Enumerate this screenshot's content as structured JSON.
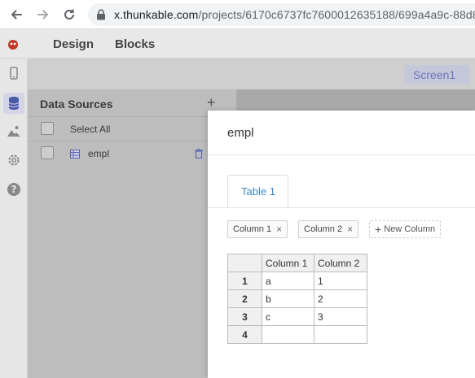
{
  "browser": {
    "url_domain": "x.thunkable.com",
    "url_path": "/projects/6170c6737fc7600012635188/699a4a9c-88d8-"
  },
  "header": {
    "tabs": [
      {
        "label": "Design"
      },
      {
        "label": "Blocks"
      }
    ]
  },
  "screen": {
    "label": "Screen1"
  },
  "data_sources": {
    "title": "Data Sources",
    "add_label": "+",
    "select_all_label": "Select All",
    "items": [
      {
        "label": "empl"
      }
    ]
  },
  "modal": {
    "title": "empl",
    "tabs": [
      {
        "label": "Table 1"
      }
    ],
    "columns": [
      {
        "label": "Column 1",
        "remove": "×"
      },
      {
        "label": "Column 2",
        "remove": "×"
      }
    ],
    "new_column_label": "New Column",
    "table": {
      "headers": [
        "Column 1",
        "Column 2"
      ],
      "rows": [
        {
          "num": "1",
          "cells": [
            "a",
            "1"
          ]
        },
        {
          "num": "2",
          "cells": [
            "b",
            "2"
          ]
        },
        {
          "num": "3",
          "cells": [
            "c",
            "3"
          ]
        },
        {
          "num": "4",
          "cells": [
            "",
            ""
          ]
        }
      ]
    }
  },
  "colors": {
    "accent": "#3b86c6",
    "screen_label_text": "#6b75b8",
    "logo": "#d33"
  },
  "icons": [
    "back-arrow-icon",
    "forward-arrow-icon",
    "reload-icon",
    "lock-icon",
    "thunkable-logo",
    "phone-icon",
    "database-icon",
    "image-icon",
    "gear-icon",
    "help-icon",
    "trash-icon",
    "table-icon"
  ]
}
